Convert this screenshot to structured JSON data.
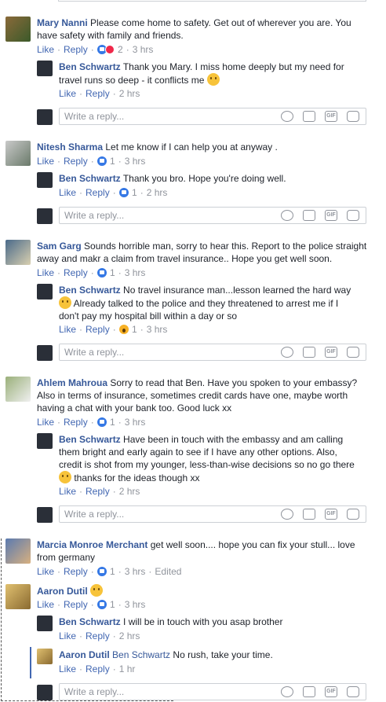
{
  "threads": [
    {
      "author": "Mary Nanni",
      "text": "Please come home to safety. Get out of wherever you are. You have safety with family and friends.",
      "like": "Like",
      "reply": "Reply",
      "count": "2",
      "time": "3 hrs",
      "replies": [
        {
          "author": "Ben Schwartz",
          "text": "Thank you Mary. I miss home deeply but my need for travel runs so deep - it conflicts me",
          "like": "Like",
          "reply": "Reply",
          "time": "2 hrs"
        }
      ]
    },
    {
      "author": "Nitesh Sharma",
      "text": "Let me know if I can help you at anyway .",
      "like": "Like",
      "reply": "Reply",
      "count": "1",
      "time": "3 hrs",
      "replies": [
        {
          "author": "Ben Schwartz",
          "text": "Thank you bro. Hope you're doing well.",
          "like": "Like",
          "reply": "Reply",
          "count": "1",
          "time": "2 hrs"
        }
      ]
    },
    {
      "author": "Sam Garg",
      "text": "Sounds horrible man, sorry to hear this. Report to the police straight away and makr a claim from travel insurance.. Hope you get well soon.",
      "like": "Like",
      "reply": "Reply",
      "count": "1",
      "time": "3 hrs",
      "replies": [
        {
          "author": "Ben Schwartz",
          "text_a": "No travel insurance man...lesson learned the hard way",
          "text_b": "Already talked to the police and they threatened to arrest me if I don't pay my hospital bill within a day or so",
          "like": "Like",
          "reply": "Reply",
          "count": "1",
          "time": "3 hrs"
        }
      ]
    },
    {
      "author": "Ahlem Mahroua",
      "text": "Sorry to read that Ben. Have you spoken to your embassy? Also in terms of insurance, sometimes credit cards have one, maybe worth having a chat with your bank too. Good luck xx",
      "like": "Like",
      "reply": "Reply",
      "count": "1",
      "time": "3 hrs",
      "replies": [
        {
          "author": "Ben Schwartz",
          "text_a": "Have been in touch with the embassy and am calling them bright and early again to see if I have any other options. Also, credit is shot from my younger, less-than-wise decisions so no go there",
          "text_b": "thanks for the ideas though xx",
          "like": "Like",
          "reply": "Reply",
          "time": "2 hrs"
        }
      ]
    },
    {
      "author": "Marcia Monroe Merchant",
      "text": "get well soon.... hope you can fix your stull... love from germany",
      "like": "Like",
      "reply": "Reply",
      "count": "1",
      "time": "3 hrs",
      "edited": "Edited"
    },
    {
      "author": "Aaron Dutil",
      "like": "Like",
      "reply": "Reply",
      "count": "1",
      "time": "3 hrs",
      "replies": [
        {
          "author": "Ben Schwartz",
          "text": "I will be in touch with you asap brother",
          "like": "Like",
          "reply": "Reply",
          "time": "2 hrs"
        },
        {
          "author": "Aaron Dutil",
          "mention": "Ben Schwartz",
          "text": "No rush, take your time.",
          "like": "Like",
          "reply": "Reply",
          "time": "1 hr"
        }
      ]
    }
  ],
  "reply_placeholder": "Write a reply...",
  "gif_label": "GIF",
  "colors": {
    "link": "#365899",
    "meta": "#90949c",
    "like_blue": "#3578e5",
    "border": "#ccd0d5"
  }
}
